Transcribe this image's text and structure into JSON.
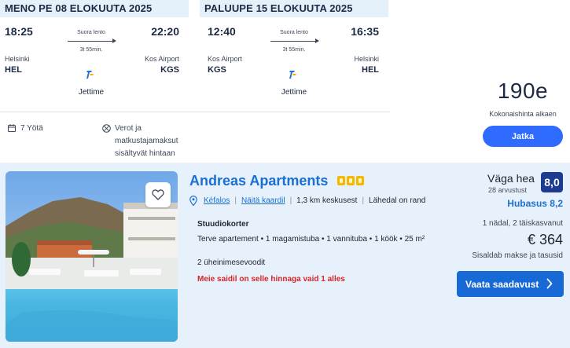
{
  "flight": {
    "outbound": {
      "header": "MENO PE 08 ELOKUUTA 2025",
      "dep_time": "18:25",
      "arr_time": "22:20",
      "flight_kind": "Suora lento",
      "duration": "3t 55min.",
      "dep_city": "Helsinki",
      "arr_city": "Kos Airport",
      "dep_code": "HEL",
      "arr_code": "KGS",
      "airline": "Jettime"
    },
    "return": {
      "header": "PALUUPE 15 ELOKUUTA 2025",
      "dep_time": "12:40",
      "arr_time": "16:35",
      "flight_kind": "Suora lento",
      "duration": "3t 55min.",
      "dep_city": "Kos Airport",
      "arr_city": "Helsinki",
      "dep_code": "KGS",
      "arr_code": "HEL",
      "airline": "Jettime"
    },
    "features": {
      "nights": "7 Yötä",
      "taxes": "Verot ja matkustajamaksut sisältyvät hintaan"
    },
    "price": "190e",
    "price_label": "Kokonaishinta alkaen",
    "continue_label": "Jatka"
  },
  "hotel": {
    "name": "Andreas Apartments",
    "star_count": 3,
    "location": "Kéfalos",
    "map_link": "Näitä kaardil",
    "distance": "1,3 km keskusest",
    "beach": "Lähedal on rand",
    "room_type": "Stuudiokorter",
    "room_desc": "Terve apartement • 1 magamistuba • 1 vannituba • 1 köök • 25 m²",
    "room_extra": "2 üheinimesevoodit",
    "urgent": "Meie saidil on selle hinnaga vaid 1 alles",
    "rating_label": "Väga hea",
    "review_count": "28 arvustust",
    "score": "8,0",
    "sub_rating": "Hubasus 8,2",
    "stay_info": "1 nädal, 2 täiskasvanut",
    "price": "€ 364",
    "price_note": "Sisaldab makse ja tasusid",
    "availability_label": "Vaata saadavust"
  },
  "colors": {
    "accent_blue": "#2f6bff",
    "link_blue": "#1b6fd0",
    "score_navy": "#1c3b91",
    "urgent_red": "#d6262a",
    "star_gold": "#f5b800",
    "header_tint": "#e4f1fb",
    "card_tint": "#e6f1fb"
  },
  "icons": {
    "nights": "calendar-icon",
    "taxes": "no-fee-icon",
    "airline": "jettime-logo",
    "location": "map-pin-icon",
    "favorite": "heart-icon",
    "availability": "chevron-right-icon"
  }
}
